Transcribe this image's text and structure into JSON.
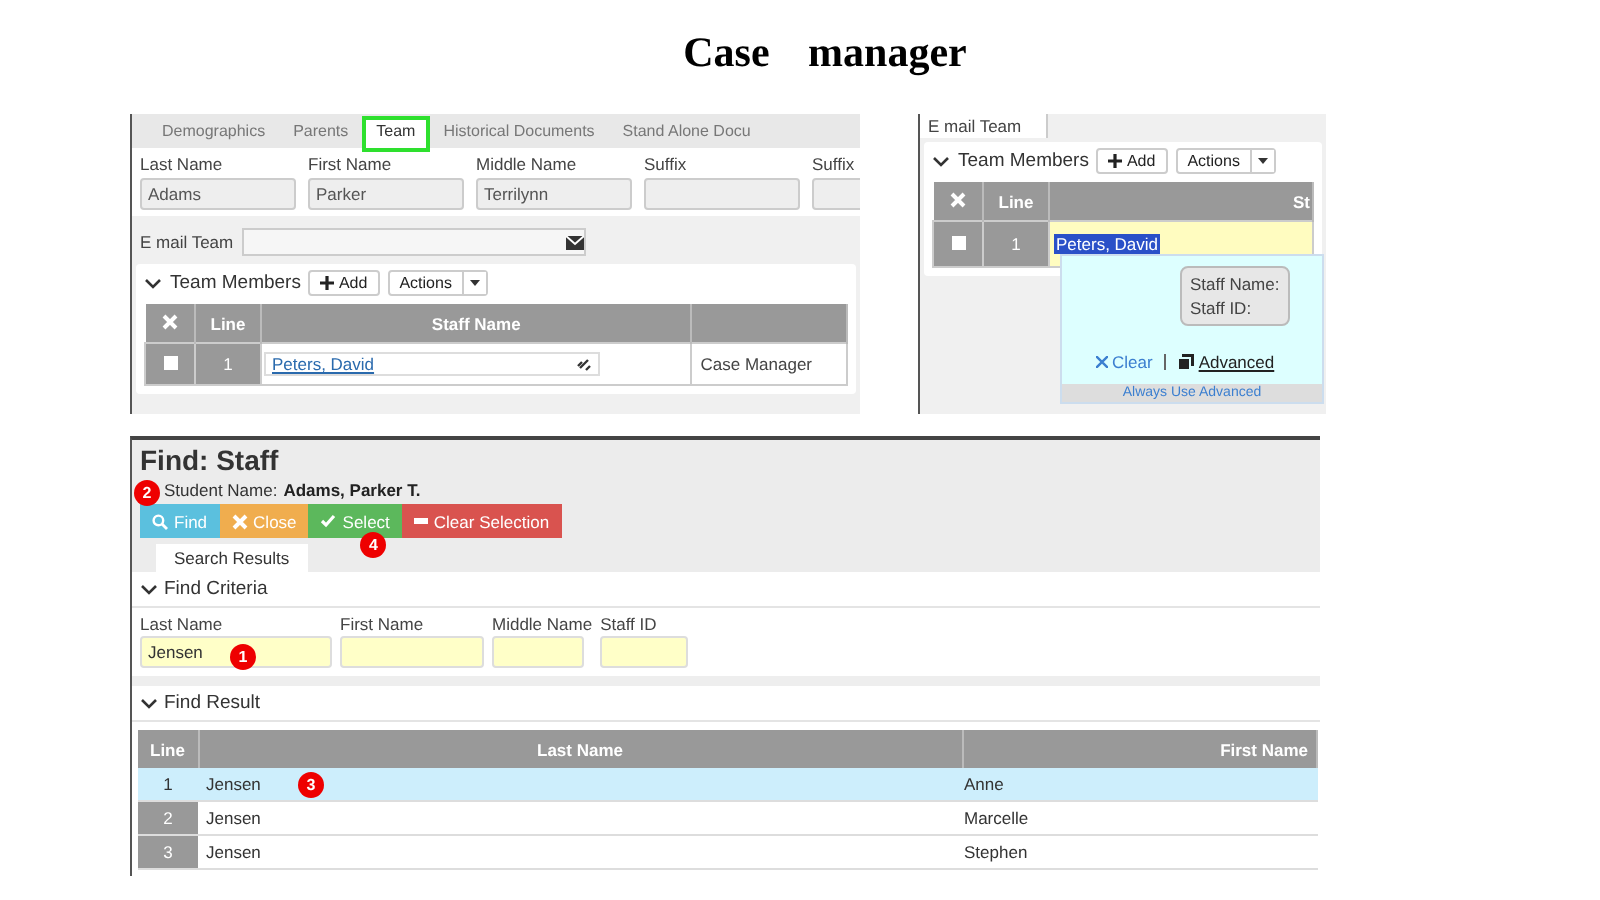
{
  "title": "Case manager",
  "team_panel": {
    "tabs": [
      {
        "label": "Demographics",
        "selected": false
      },
      {
        "label": "Parents",
        "selected": false
      },
      {
        "label": "Team",
        "selected": true
      },
      {
        "label": "Historical Documents",
        "selected": false
      },
      {
        "label": "Stand Alone Docu",
        "selected": false
      }
    ],
    "name_fields": [
      {
        "label": "Last Name",
        "value": "Adams"
      },
      {
        "label": "First Name",
        "value": "Parker"
      },
      {
        "label": "Middle Name",
        "value": "Terrilynn"
      },
      {
        "label": "Suffix"
      },
      {
        "label": "Suffix"
      }
    ],
    "email_label": "E mail Team",
    "section": "Team Members",
    "add_button": "Add",
    "actions_button": "Actions",
    "columns": [
      "Line",
      "Staff Name"
    ],
    "rows": [
      {
        "checked": false,
        "line": "1",
        "staff_name": "Peters, David",
        "role": "Case Manager"
      }
    ]
  },
  "lookup_panel": {
    "email_label": "E mail Team",
    "section": "Team Members",
    "add_button": "Add",
    "actions_button": "Actions",
    "columns": [
      "Line",
      "St"
    ],
    "row": {
      "checked": false,
      "line": "1",
      "value": "Peters, David"
    },
    "tooltip": [
      "Staff Name:",
      "Staff ID:"
    ],
    "clear_link": "Clear",
    "advanced_link": "Advanced",
    "footer": "Always Use Advanced"
  },
  "find_panel": {
    "title": "Find: Staff",
    "student_label": "Student Name:",
    "student_value": "Adams, Parker T.",
    "buttons": [
      {
        "kind": "find",
        "label": "Find",
        "badge": "2"
      },
      {
        "kind": "close",
        "label": "Close"
      },
      {
        "kind": "select",
        "label": "Select",
        "badge": "4"
      },
      {
        "kind": "clear",
        "label": "Clear Selection"
      }
    ],
    "tab": "Search Results",
    "criteria_section": "Find Criteria",
    "fields": [
      {
        "label": "Last Name",
        "value": "Jensen",
        "badge": "1"
      },
      {
        "label": "First Name"
      },
      {
        "label": "Middle Name"
      },
      {
        "label": "Staff ID"
      }
    ],
    "result_section": "Find Result",
    "columns": [
      "Line",
      "Last Name",
      "First Name"
    ],
    "rows": [
      {
        "line": "1",
        "last_name": "Jensen",
        "first_name": "Anne",
        "selected": true,
        "badge": "3"
      },
      {
        "line": "2",
        "last_name": "Jensen",
        "first_name": "Marcelle",
        "selected": false
      },
      {
        "line": "3",
        "last_name": "Jensen",
        "first_name": "Stephen",
        "selected": false
      }
    ]
  }
}
